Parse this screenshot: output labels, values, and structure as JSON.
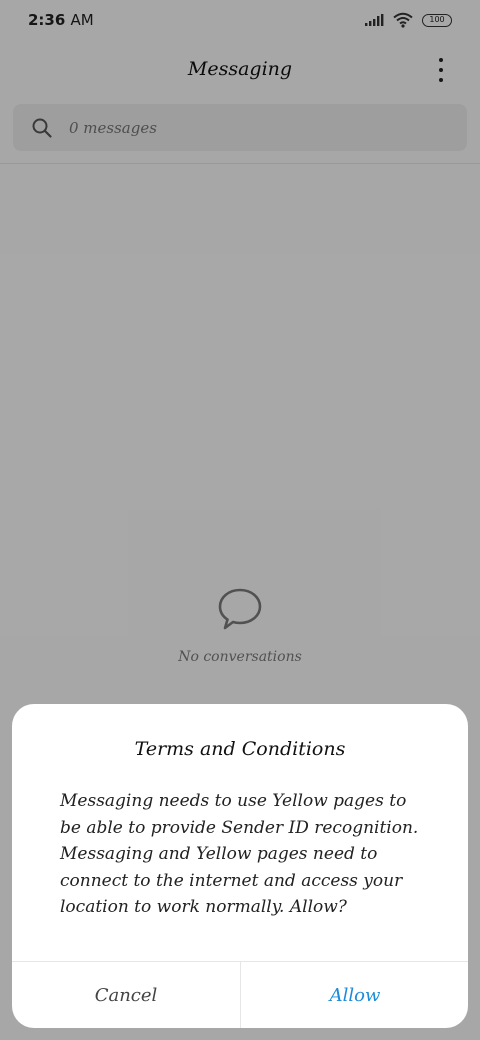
{
  "status_bar": {
    "time": "2:36",
    "ampm": "AM",
    "battery": "100",
    "icons": [
      "signal-icon",
      "wifi-icon",
      "battery-icon"
    ]
  },
  "header": {
    "title": "Messaging",
    "menu_icon": "more-vertical-icon"
  },
  "search": {
    "placeholder": "0 messages",
    "icon": "search-icon"
  },
  "empty_state": {
    "icon": "chat-bubble-icon",
    "text": "No conversations"
  },
  "dialog": {
    "title": "Terms and Conditions",
    "body": "Messaging needs to use Yellow pages to be able to provide Sender ID recognition. Messaging and Yellow pages need to connect to the internet and access your location to work normally. Allow?",
    "cancel_label": "Cancel",
    "allow_label": "Allow"
  },
  "colors": {
    "accent": "#1a8cd8",
    "overlay": "rgba(0,0,0,0.33)"
  }
}
